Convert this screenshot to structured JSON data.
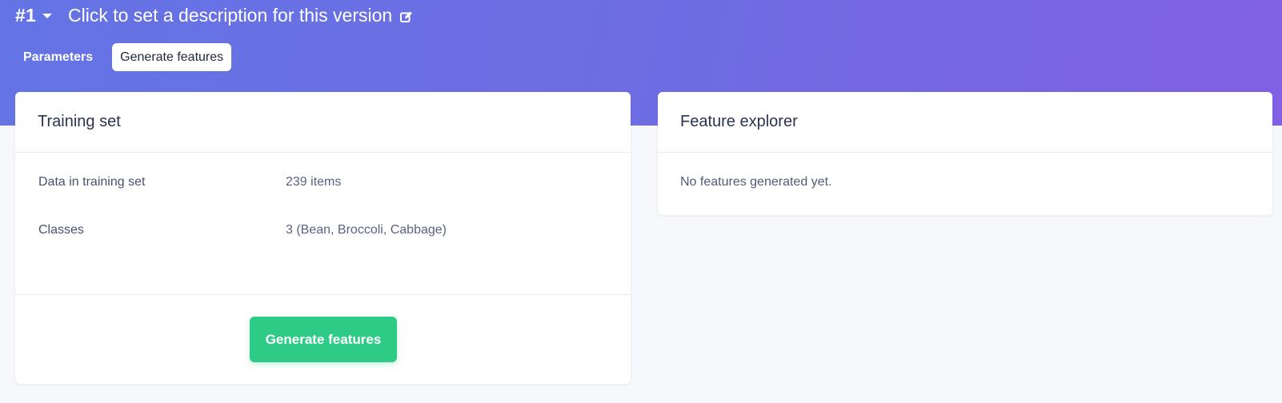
{
  "header": {
    "version_number": "#1",
    "version_description": "Click to set a description for this version",
    "caret_icon": "caret-down-icon",
    "edit_icon": "edit-icon",
    "gradient_start": "#6474e4",
    "gradient_end": "#8160e3"
  },
  "tabs": [
    {
      "label": "Parameters",
      "active": false
    },
    {
      "label": "Generate features",
      "active": true
    }
  ],
  "training_set": {
    "title": "Training set",
    "rows": [
      {
        "label": "Data in training set",
        "value": "239 items"
      },
      {
        "label": "Classes",
        "value": "3 (Bean, Broccoli, Cabbage)"
      }
    ],
    "button_label": "Generate features",
    "button_color": "#2ecb87"
  },
  "feature_explorer": {
    "title": "Feature explorer",
    "empty_message": "No features generated yet."
  }
}
